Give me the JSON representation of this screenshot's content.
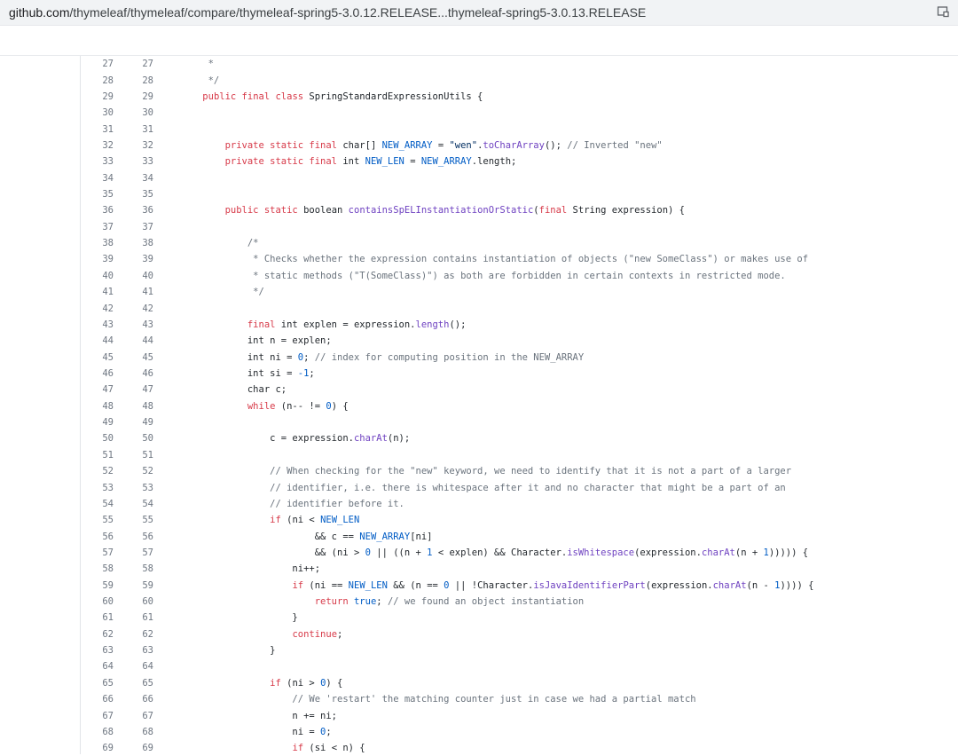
{
  "address_bar": {
    "host": "github.com",
    "path": "/thymeleaf/thymeleaf/compare/thymeleaf-spring5-3.0.12.RELEASE...thymeleaf-spring5-3.0.13.RELEASE",
    "action_icon": "screen-capture-icon"
  },
  "diff": {
    "lines": [
      {
        "old": "27",
        "new": "27",
        "tokens": [
          {
            "t": "     *",
            "c": "cm"
          }
        ]
      },
      {
        "old": "28",
        "new": "28",
        "tokens": [
          {
            "t": "     */",
            "c": "cm"
          }
        ]
      },
      {
        "old": "29",
        "new": "29",
        "tokens": [
          {
            "t": "    ",
            "c": ""
          },
          {
            "t": "public final class",
            "c": "kw"
          },
          {
            "t": " SpringStandardExpressionUtils {",
            "c": ""
          }
        ]
      },
      {
        "old": "30",
        "new": "30",
        "tokens": []
      },
      {
        "old": "31",
        "new": "31",
        "tokens": []
      },
      {
        "old": "32",
        "new": "32",
        "tokens": [
          {
            "t": "        ",
            "c": ""
          },
          {
            "t": "private static final",
            "c": "kw"
          },
          {
            "t": " char[] ",
            "c": ""
          },
          {
            "t": "NEW_ARRAY",
            "c": "cn"
          },
          {
            "t": " = ",
            "c": ""
          },
          {
            "t": "\"wen\"",
            "c": "st"
          },
          {
            "t": ".",
            "c": ""
          },
          {
            "t": "toCharArray",
            "c": "fn"
          },
          {
            "t": "(); ",
            "c": ""
          },
          {
            "t": "// Inverted \"new\"",
            "c": "cm"
          }
        ]
      },
      {
        "old": "33",
        "new": "33",
        "tokens": [
          {
            "t": "        ",
            "c": ""
          },
          {
            "t": "private static final",
            "c": "kw"
          },
          {
            "t": " int ",
            "c": ""
          },
          {
            "t": "NEW_LEN",
            "c": "cn"
          },
          {
            "t": " = ",
            "c": ""
          },
          {
            "t": "NEW_ARRAY",
            "c": "cn"
          },
          {
            "t": ".length;",
            "c": ""
          }
        ]
      },
      {
        "old": "34",
        "new": "34",
        "tokens": []
      },
      {
        "old": "35",
        "new": "35",
        "tokens": []
      },
      {
        "old": "36",
        "new": "36",
        "tokens": [
          {
            "t": "        ",
            "c": ""
          },
          {
            "t": "public static",
            "c": "kw"
          },
          {
            "t": " boolean ",
            "c": ""
          },
          {
            "t": "containsSpELInstantiationOrStatic",
            "c": "fn"
          },
          {
            "t": "(",
            "c": ""
          },
          {
            "t": "final",
            "c": "kw"
          },
          {
            "t": " String expression) {",
            "c": ""
          }
        ]
      },
      {
        "old": "37",
        "new": "37",
        "tokens": []
      },
      {
        "old": "38",
        "new": "38",
        "tokens": [
          {
            "t": "            /*",
            "c": "cm"
          }
        ]
      },
      {
        "old": "39",
        "new": "39",
        "tokens": [
          {
            "t": "             * Checks whether the expression contains instantiation of objects (\"new SomeClass\") or makes use of",
            "c": "cm"
          }
        ]
      },
      {
        "old": "40",
        "new": "40",
        "tokens": [
          {
            "t": "             * static methods (\"T(SomeClass)\") as both are forbidden in certain contexts in restricted mode.",
            "c": "cm"
          }
        ]
      },
      {
        "old": "41",
        "new": "41",
        "tokens": [
          {
            "t": "             */",
            "c": "cm"
          }
        ]
      },
      {
        "old": "42",
        "new": "42",
        "tokens": []
      },
      {
        "old": "43",
        "new": "43",
        "tokens": [
          {
            "t": "            ",
            "c": ""
          },
          {
            "t": "final",
            "c": "kw"
          },
          {
            "t": " int explen = expression.",
            "c": ""
          },
          {
            "t": "length",
            "c": "fn"
          },
          {
            "t": "();",
            "c": ""
          }
        ]
      },
      {
        "old": "44",
        "new": "44",
        "tokens": [
          {
            "t": "            int n = explen;",
            "c": ""
          }
        ]
      },
      {
        "old": "45",
        "new": "45",
        "tokens": [
          {
            "t": "            int ni = ",
            "c": ""
          },
          {
            "t": "0",
            "c": "cn"
          },
          {
            "t": "; ",
            "c": ""
          },
          {
            "t": "// index for computing position in the NEW_ARRAY",
            "c": "cm"
          }
        ]
      },
      {
        "old": "46",
        "new": "46",
        "tokens": [
          {
            "t": "            int si = ",
            "c": ""
          },
          {
            "t": "-1",
            "c": "cn"
          },
          {
            "t": ";",
            "c": ""
          }
        ]
      },
      {
        "old": "47",
        "new": "47",
        "tokens": [
          {
            "t": "            char c;",
            "c": ""
          }
        ]
      },
      {
        "old": "48",
        "new": "48",
        "tokens": [
          {
            "t": "            ",
            "c": ""
          },
          {
            "t": "while",
            "c": "kw"
          },
          {
            "t": " (n-- != ",
            "c": ""
          },
          {
            "t": "0",
            "c": "cn"
          },
          {
            "t": ") {",
            "c": ""
          }
        ]
      },
      {
        "old": "49",
        "new": "49",
        "tokens": []
      },
      {
        "old": "50",
        "new": "50",
        "tokens": [
          {
            "t": "                c = expression.",
            "c": ""
          },
          {
            "t": "charAt",
            "c": "fn"
          },
          {
            "t": "(n);",
            "c": ""
          }
        ]
      },
      {
        "old": "51",
        "new": "51",
        "tokens": []
      },
      {
        "old": "52",
        "new": "52",
        "tokens": [
          {
            "t": "                // When checking for the \"new\" keyword, we need to identify that it is not a part of a larger",
            "c": "cm"
          }
        ]
      },
      {
        "old": "53",
        "new": "53",
        "tokens": [
          {
            "t": "                // identifier, i.e. there is whitespace after it and no character that might be a part of an",
            "c": "cm"
          }
        ]
      },
      {
        "old": "54",
        "new": "54",
        "tokens": [
          {
            "t": "                // identifier before it.",
            "c": "cm"
          }
        ]
      },
      {
        "old": "55",
        "new": "55",
        "tokens": [
          {
            "t": "                ",
            "c": ""
          },
          {
            "t": "if",
            "c": "kw"
          },
          {
            "t": " (ni < ",
            "c": ""
          },
          {
            "t": "NEW_LEN",
            "c": "cn"
          }
        ]
      },
      {
        "old": "56",
        "new": "56",
        "tokens": [
          {
            "t": "                        && c == ",
            "c": ""
          },
          {
            "t": "NEW_ARRAY",
            "c": "cn"
          },
          {
            "t": "[ni]",
            "c": ""
          }
        ]
      },
      {
        "old": "57",
        "new": "57",
        "tokens": [
          {
            "t": "                        && (ni > ",
            "c": ""
          },
          {
            "t": "0",
            "c": "cn"
          },
          {
            "t": " || ((n + ",
            "c": ""
          },
          {
            "t": "1",
            "c": "cn"
          },
          {
            "t": " < explen) && Character.",
            "c": ""
          },
          {
            "t": "isWhitespace",
            "c": "fn"
          },
          {
            "t": "(expression.",
            "c": ""
          },
          {
            "t": "charAt",
            "c": "fn"
          },
          {
            "t": "(n + ",
            "c": ""
          },
          {
            "t": "1",
            "c": "cn"
          },
          {
            "t": "))))) {",
            "c": ""
          }
        ]
      },
      {
        "old": "58",
        "new": "58",
        "tokens": [
          {
            "t": "                    ni++;",
            "c": ""
          }
        ]
      },
      {
        "old": "59",
        "new": "59",
        "tokens": [
          {
            "t": "                    ",
            "c": ""
          },
          {
            "t": "if",
            "c": "kw"
          },
          {
            "t": " (ni == ",
            "c": ""
          },
          {
            "t": "NEW_LEN",
            "c": "cn"
          },
          {
            "t": " && (n == ",
            "c": ""
          },
          {
            "t": "0",
            "c": "cn"
          },
          {
            "t": " || !Character.",
            "c": ""
          },
          {
            "t": "isJavaIdentifierPart",
            "c": "fn"
          },
          {
            "t": "(expression.",
            "c": ""
          },
          {
            "t": "charAt",
            "c": "fn"
          },
          {
            "t": "(n - ",
            "c": ""
          },
          {
            "t": "1",
            "c": "cn"
          },
          {
            "t": ")))) {",
            "c": ""
          }
        ]
      },
      {
        "old": "60",
        "new": "60",
        "tokens": [
          {
            "t": "                        ",
            "c": ""
          },
          {
            "t": "return",
            "c": "kw"
          },
          {
            "t": " ",
            "c": ""
          },
          {
            "t": "true",
            "c": "cn"
          },
          {
            "t": "; ",
            "c": ""
          },
          {
            "t": "// we found an object instantiation",
            "c": "cm"
          }
        ]
      },
      {
        "old": "61",
        "new": "61",
        "tokens": [
          {
            "t": "                    }",
            "c": ""
          }
        ]
      },
      {
        "old": "62",
        "new": "62",
        "tokens": [
          {
            "t": "                    ",
            "c": ""
          },
          {
            "t": "continue",
            "c": "kw"
          },
          {
            "t": ";",
            "c": ""
          }
        ]
      },
      {
        "old": "63",
        "new": "63",
        "tokens": [
          {
            "t": "                }",
            "c": ""
          }
        ]
      },
      {
        "old": "64",
        "new": "64",
        "tokens": []
      },
      {
        "old": "65",
        "new": "65",
        "tokens": [
          {
            "t": "                ",
            "c": ""
          },
          {
            "t": "if",
            "c": "kw"
          },
          {
            "t": " (ni > ",
            "c": ""
          },
          {
            "t": "0",
            "c": "cn"
          },
          {
            "t": ") {",
            "c": ""
          }
        ]
      },
      {
        "old": "66",
        "new": "66",
        "tokens": [
          {
            "t": "                    // We 'restart' the matching counter just in case we had a partial match",
            "c": "cm"
          }
        ]
      },
      {
        "old": "67",
        "new": "67",
        "tokens": [
          {
            "t": "                    n += ni;",
            "c": ""
          }
        ]
      },
      {
        "old": "68",
        "new": "68",
        "tokens": [
          {
            "t": "                    ni = ",
            "c": ""
          },
          {
            "t": "0",
            "c": "cn"
          },
          {
            "t": ";",
            "c": ""
          }
        ]
      },
      {
        "old": "69",
        "new": "69",
        "tokens": [
          {
            "t": "                    ",
            "c": ""
          },
          {
            "t": "if",
            "c": "kw"
          },
          {
            "t": " (si < n) {",
            "c": ""
          }
        ]
      }
    ]
  }
}
